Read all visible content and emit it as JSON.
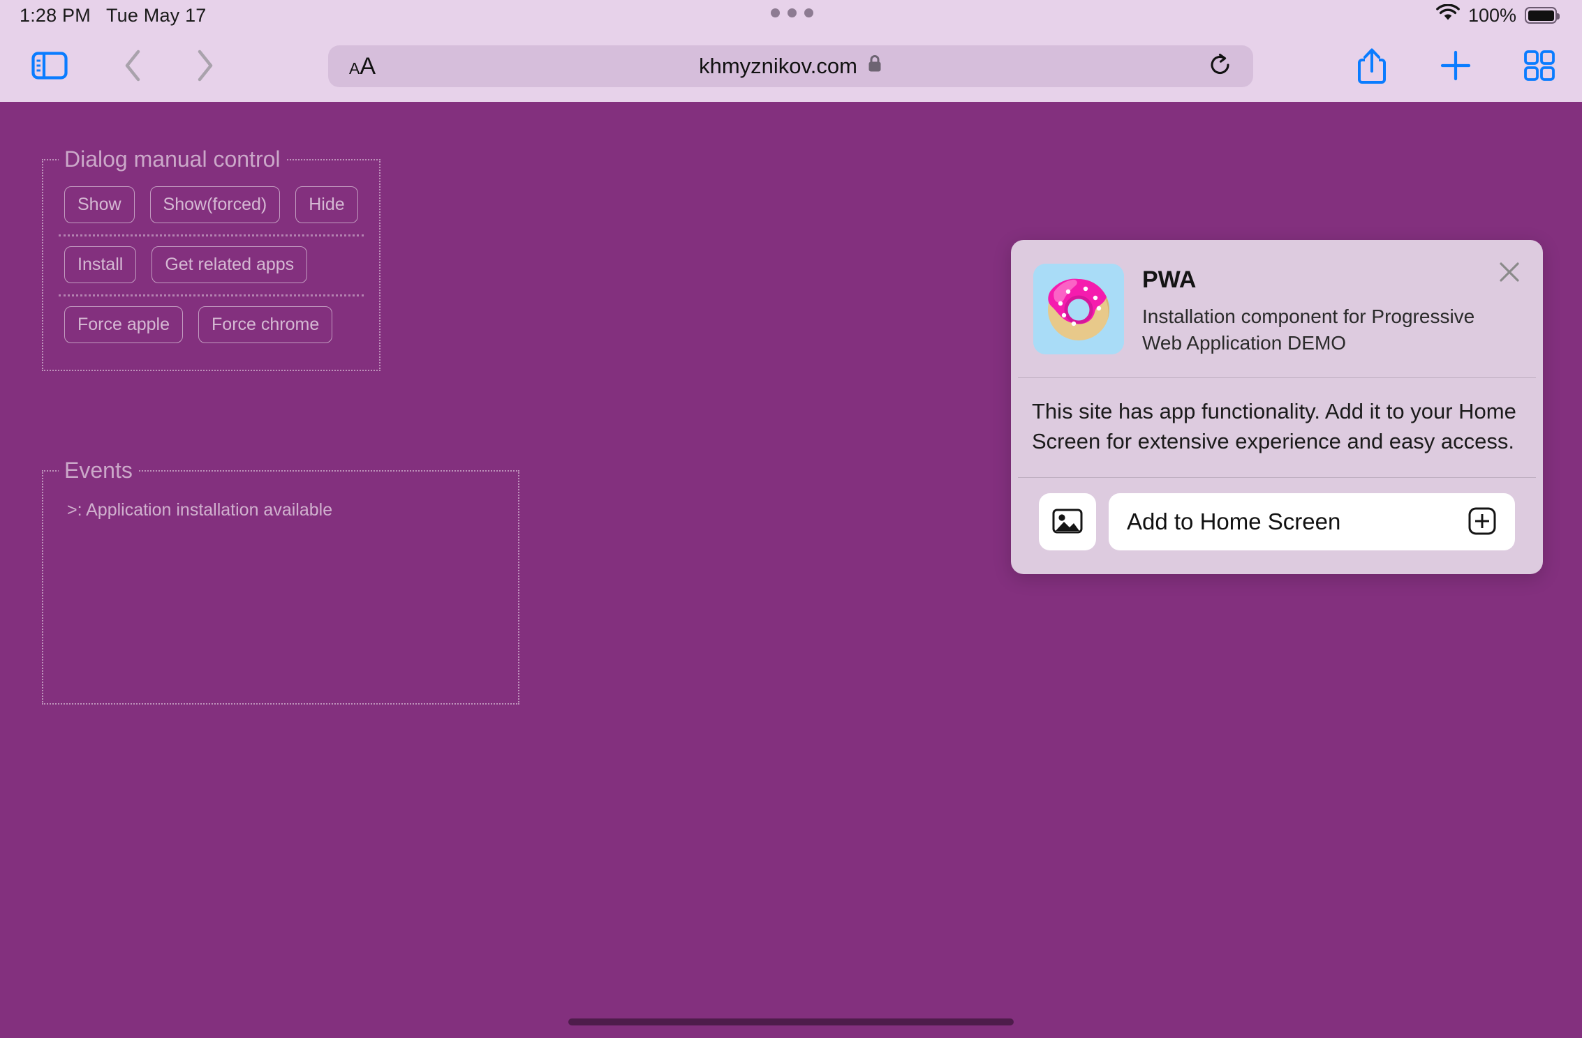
{
  "statusbar": {
    "time": "1:28 PM",
    "date": "Tue May 17",
    "battery_percent": "100%",
    "wifi_icon": "wifi-icon",
    "battery_icon": "battery-full-icon"
  },
  "toolbar": {
    "sidebar_icon": "sidebar-toggle-icon",
    "back_icon": "chevron-left-icon",
    "forward_icon": "chevron-right-icon",
    "text_size_small": "A",
    "text_size_large": "A",
    "url": "khmyznikov.com",
    "lock_icon": "lock-icon",
    "reload_icon": "reload-icon",
    "share_icon": "share-icon",
    "new_tab_icon": "plus-icon",
    "tabs_icon": "tab-overview-icon"
  },
  "page": {
    "dialog_panel": {
      "legend": "Dialog manual control",
      "rows": [
        [
          "Show",
          "Show(forced)",
          "Hide"
        ],
        [
          "Install",
          "Get related apps"
        ],
        [
          "Force apple",
          "Force chrome"
        ]
      ]
    },
    "events_panel": {
      "legend": "Events",
      "log": [
        ">: Application installation available"
      ]
    }
  },
  "pwa_dialog": {
    "app_icon": "donut-app-icon",
    "title": "PWA",
    "description": "Installation component for Progressive Web Application DEMO",
    "close_icon": "close-icon",
    "body": "This site has app functionality. Add it to your Home Screen for extensive experience and easy access.",
    "image_button_icon": "image-icon",
    "add_button_label": "Add to Home Screen",
    "add_button_icon": "plus-square-icon"
  },
  "colors": {
    "page_background": "#83307e",
    "chrome_background": "#e7d2ea",
    "urlbar_background": "#d6bedb",
    "accent_blue": "#0a7cff",
    "dialog_background": "#ddcbdf",
    "app_icon_background": "#a9dcf7",
    "donut_frosting": "#f51cae",
    "donut_dough": "#e8c98a"
  }
}
